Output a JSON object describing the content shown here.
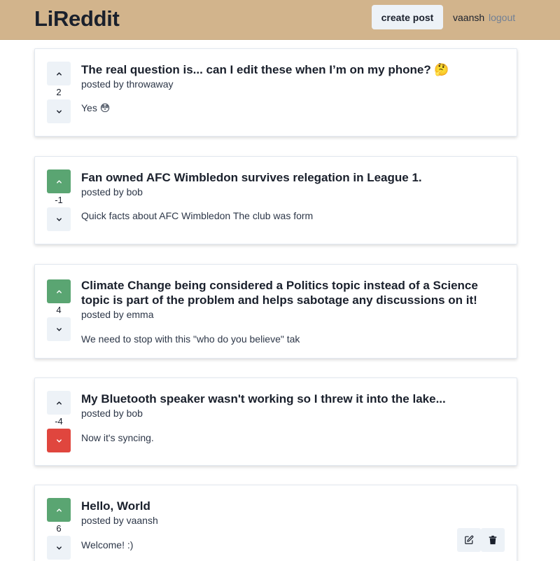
{
  "navbar": {
    "logo": "LiReddit",
    "create_post_label": "create post",
    "username": "vaansh",
    "logout_label": "logout"
  },
  "posts": [
    {
      "title": "The real question is... can I edit these when I’m on my phone? 🤔",
      "author": "posted by throwaway",
      "points": "2",
      "snippet": "Yes 😳",
      "vote_status": "none"
    },
    {
      "title": "Fan owned AFC Wimbledon survives relegation in League 1.",
      "author": "posted by bob",
      "points": "-1",
      "snippet": "Quick facts about AFC Wimbledon The club was form",
      "vote_status": "upvoted"
    },
    {
      "title": "Climate Change being considered a Politics topic instead of a Science topic is part of the problem and helps sabotage any discussions on it!",
      "author": "posted by emma",
      "points": "4",
      "snippet": "We need to stop with this \"who do you believe\" tak",
      "vote_status": "upvoted"
    },
    {
      "title": "My Bluetooth speaker wasn't working so I threw it into the lake...",
      "author": "posted by bob",
      "points": "-4",
      "snippet": "Now it's syncing.",
      "vote_status": "downvoted"
    },
    {
      "title": "Hello, World",
      "author": "posted by vaansh",
      "points": "6",
      "snippet": "Welcome! :)",
      "vote_status": "upvoted",
      "owner_actions": [
        "edit-icon",
        "trash-icon"
      ]
    }
  ],
  "colors": {
    "navbar": "#d2b48c",
    "upvoted": "#5aa572",
    "downvoted": "#e0463e",
    "neutral_button": "#edf2f7"
  }
}
